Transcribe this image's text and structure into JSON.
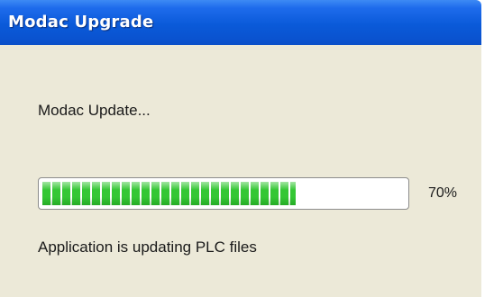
{
  "window": {
    "title": "Modac Upgrade"
  },
  "dialog": {
    "heading": "Modac Update...",
    "progress": {
      "value": 70,
      "label": "70%"
    },
    "status": "Application is updating PLC files"
  },
  "colors": {
    "titlebar": "#0a5ad9",
    "client_background": "#ece9d8",
    "progress_fill": "#34c734"
  }
}
